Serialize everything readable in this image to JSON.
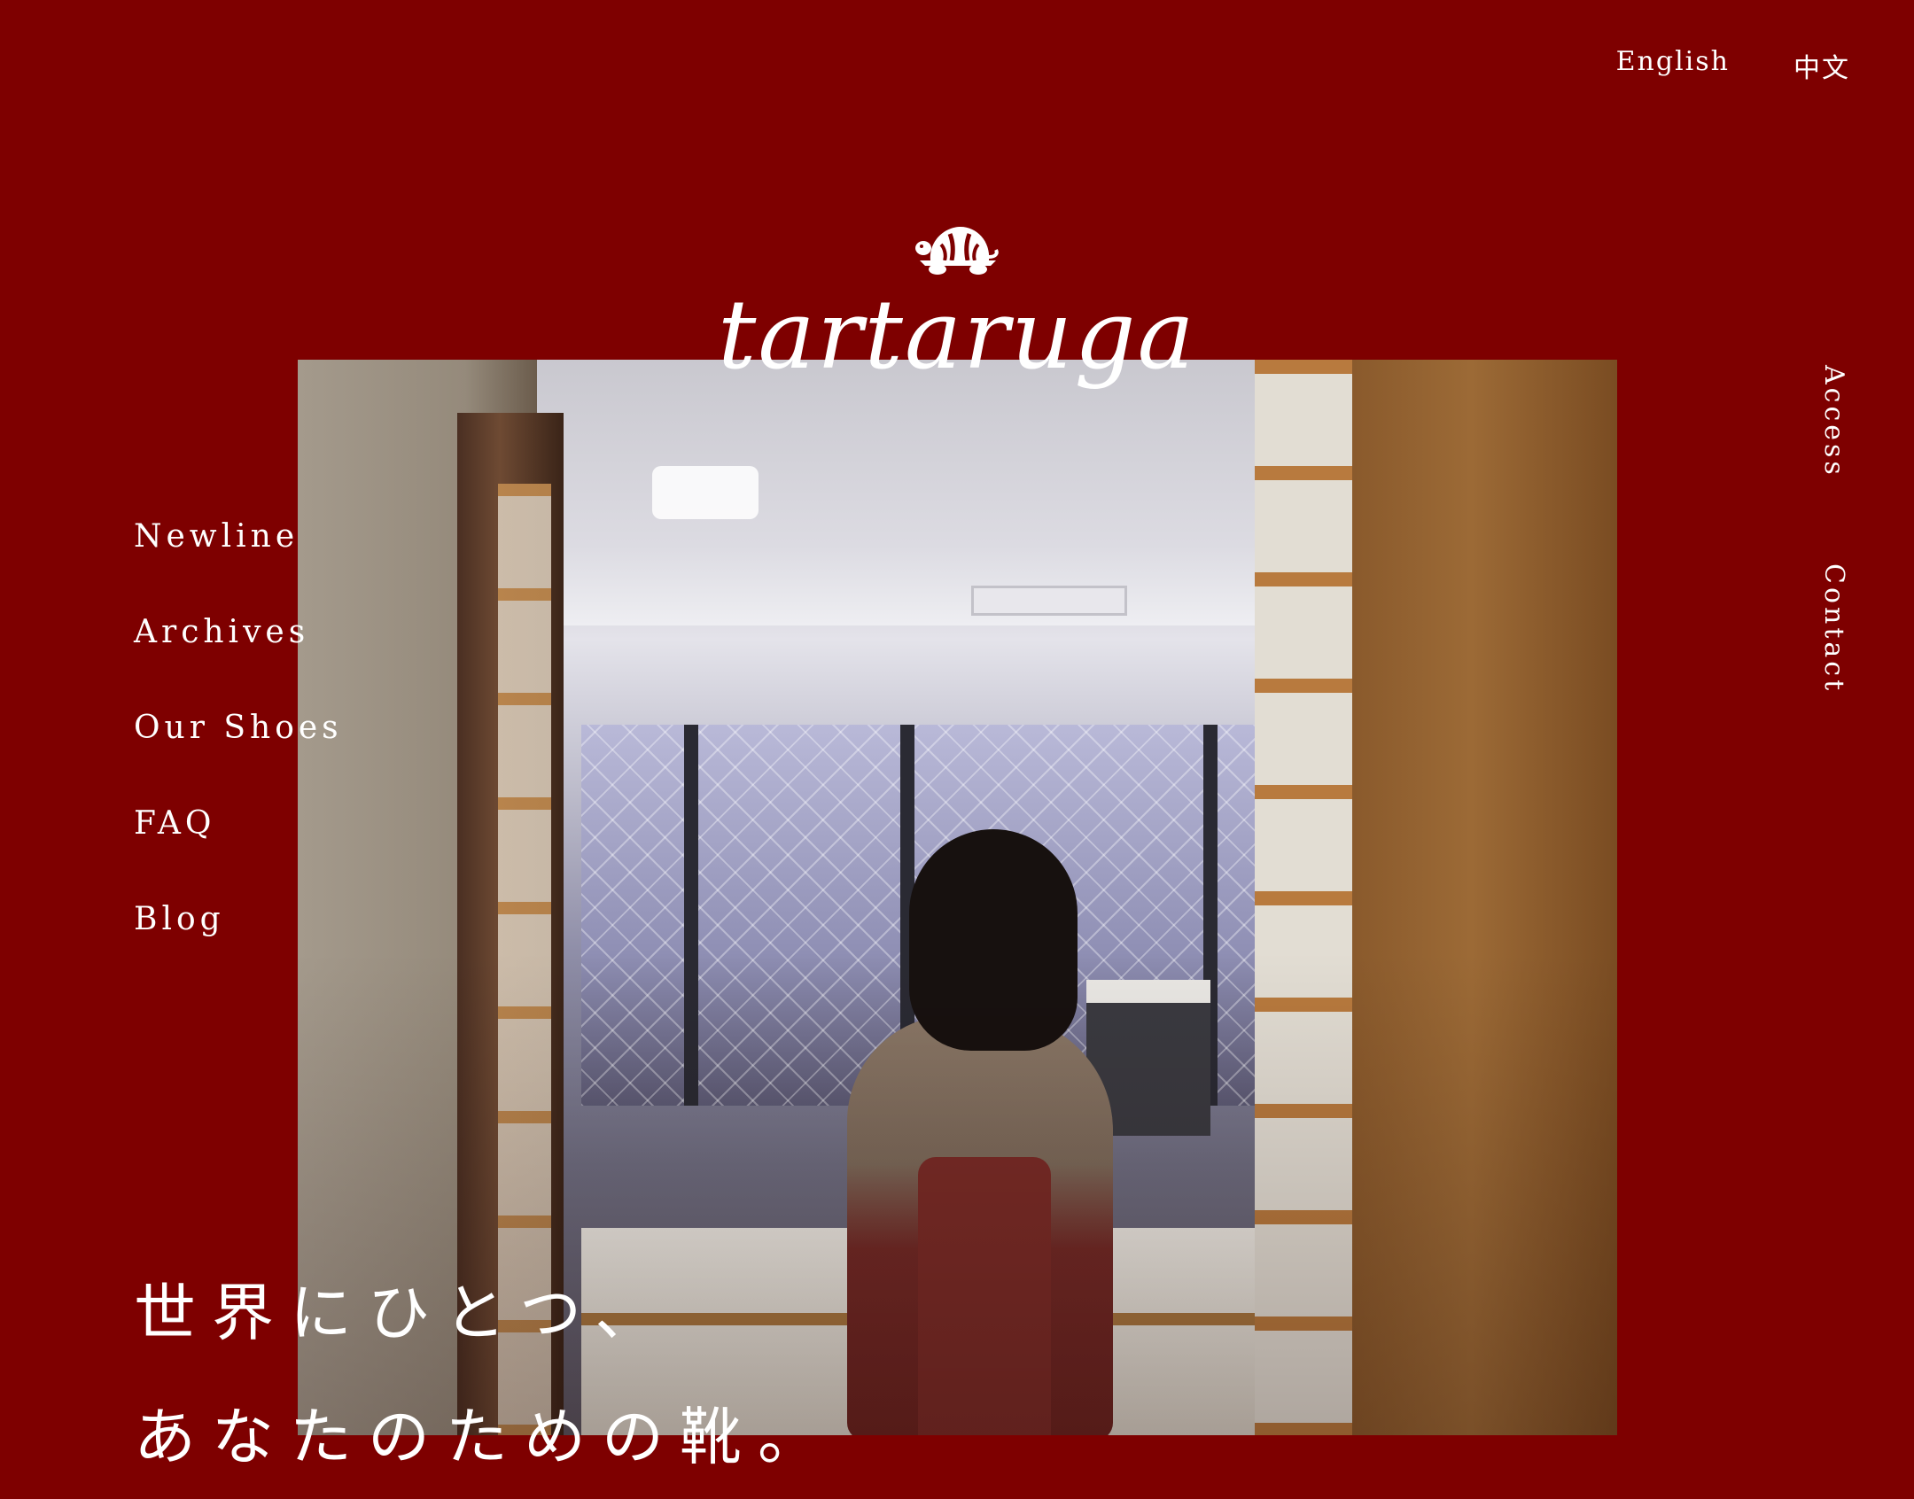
{
  "header": {
    "lang_english": "English",
    "lang_chinese": "中文"
  },
  "logo": {
    "icon": "turtle-icon",
    "wordmark": "tartaruga"
  },
  "left_nav": {
    "items": [
      {
        "label": "Newline"
      },
      {
        "label": "Archives"
      },
      {
        "label": "Our Shoes"
      },
      {
        "label": "FAQ"
      },
      {
        "label": "Blog"
      }
    ]
  },
  "right_nav": {
    "items": [
      {
        "label": "Access"
      },
      {
        "label": "Contact"
      }
    ]
  },
  "hero": {
    "headline_line1": "世界にひとつ、",
    "headline_line2": "あなたのための靴。"
  },
  "colors": {
    "background": "#7e0000",
    "text": "#ffffff"
  }
}
